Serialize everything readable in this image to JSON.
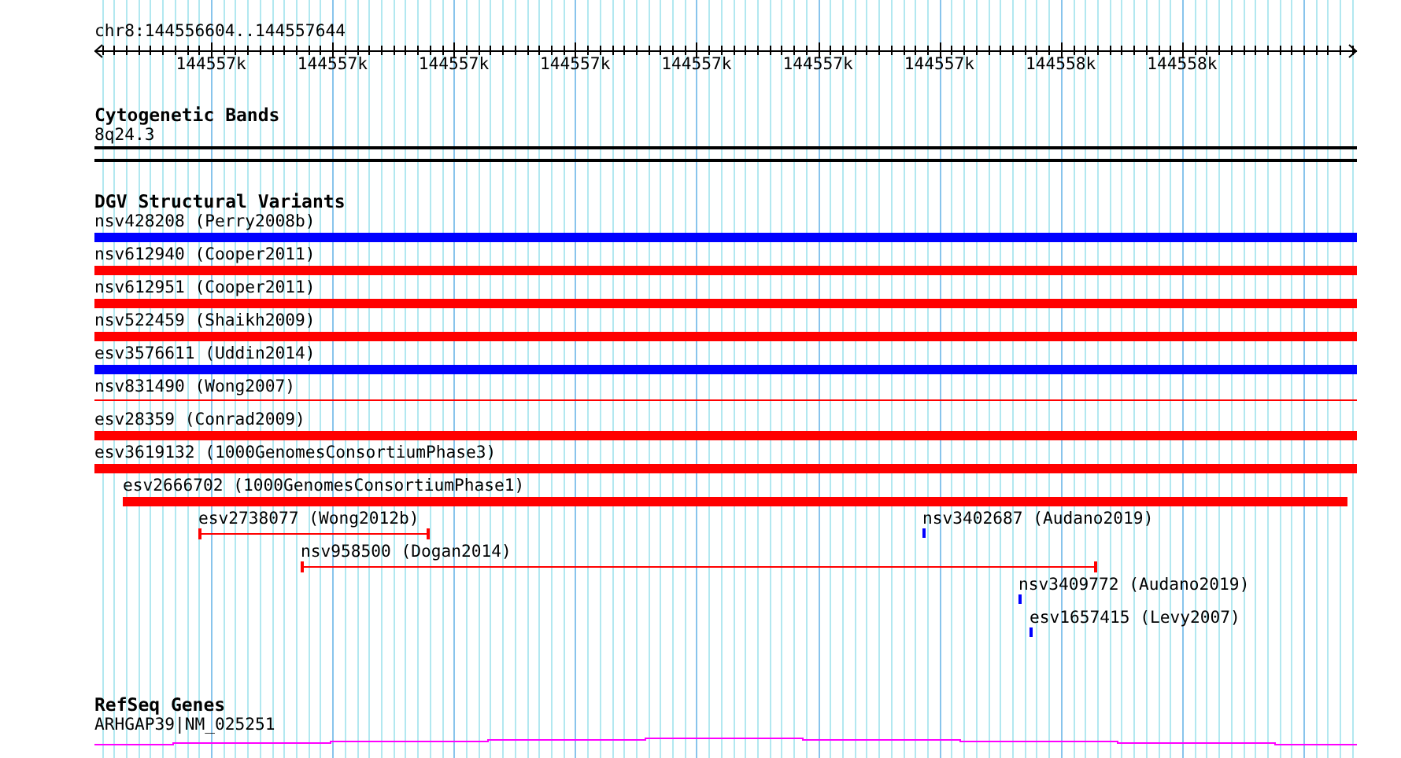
{
  "ruler": {
    "location": "chr8:144556604..144557644",
    "ticks": [
      {
        "label": "144557k"
      },
      {
        "label": "144557k"
      },
      {
        "label": "144557k"
      },
      {
        "label": "144557k"
      },
      {
        "label": "144557k"
      },
      {
        "label": "144557k"
      },
      {
        "label": "144557k"
      },
      {
        "label": "144558k"
      },
      {
        "label": "144558k"
      }
    ]
  },
  "cytogenetic_bands": {
    "title": "Cytogenetic Bands",
    "band": "8q24.3"
  },
  "dgv_structural_variants": {
    "title": "DGV Structural Variants",
    "rows": [
      {
        "features": [
          {
            "label": "nsv428208 (Perry2008b)",
            "kind": "bar",
            "color": "#0000ff"
          }
        ]
      },
      {
        "features": [
          {
            "label": "nsv612940 (Cooper2011)",
            "kind": "bar",
            "color": "#ff0000"
          }
        ]
      },
      {
        "features": [
          {
            "label": "nsv612951 (Cooper2011)",
            "kind": "bar",
            "color": "#ff0000"
          }
        ]
      },
      {
        "features": [
          {
            "label": "nsv522459 (Shaikh2009)",
            "kind": "bar",
            "color": "#ff0000"
          }
        ]
      },
      {
        "features": [
          {
            "label": "esv3576611 (Uddin2014)",
            "kind": "bar",
            "color": "#0000ff"
          }
        ]
      },
      {
        "features": [
          {
            "label": "nsv831490 (Wong2007)",
            "kind": "line",
            "color": "#ff0000"
          }
        ]
      },
      {
        "features": [
          {
            "label": "esv28359 (Conrad2009)",
            "kind": "bar",
            "color": "#ff0000"
          }
        ]
      },
      {
        "features": [
          {
            "label": "esv3619132 (1000GenomesConsortiumPhase3)",
            "kind": "bar",
            "color": "#ff0000"
          }
        ]
      },
      {
        "features": [
          {
            "label": "esv2666702 (1000GenomesConsortiumPhase1)",
            "kind": "bar",
            "color": "#ff0000"
          }
        ]
      },
      {
        "features": [
          {
            "label": "esv2738077 (Wong2012b)",
            "kind": "span",
            "color": "#ff0000"
          },
          {
            "label": "nsv3402687 (Audano2019)",
            "kind": "point",
            "color": "#0000ff"
          }
        ]
      },
      {
        "features": [
          {
            "label": "nsv958500 (Dogan2014)",
            "kind": "span",
            "color": "#ff0000"
          }
        ]
      },
      {
        "features": [
          {
            "label": "nsv3409772 (Audano2019)",
            "kind": "point",
            "color": "#0000ff"
          }
        ]
      },
      {
        "features": [
          {
            "label": "esv1657415 (Levy2007)",
            "kind": "point",
            "color": "#0000ff"
          }
        ]
      }
    ]
  },
  "refseq_genes": {
    "title": "RefSeq Genes",
    "gene": "ARHGAP39|NM_025251"
  }
}
